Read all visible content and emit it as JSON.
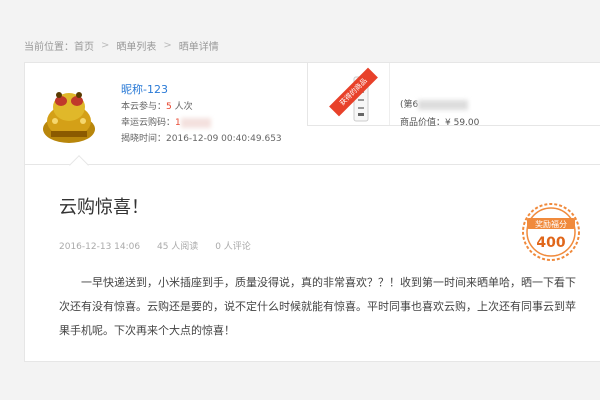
{
  "breadcrumb": {
    "prefix": "当前位置：",
    "items": [
      "首页",
      "晒单列表",
      "晒单详情"
    ]
  },
  "winner": {
    "nickname": "昵称-123",
    "participate_label": "本云参与：",
    "participate_value": "5",
    "participate_unit": "人次",
    "lucky_label": "幸运云购码：",
    "lucky_value": "1",
    "reveal_label": "揭晓时间：",
    "reveal_value": "2016-12-09 00:40:49.653"
  },
  "product": {
    "ribbon": "获得的商品",
    "name_prefix": "(第6",
    "price_label": "商品价值：",
    "price_value": "¥ 59.00"
  },
  "post": {
    "title": "云购惊喜！",
    "date": "2016-12-13 14:06",
    "reads": "45 人阅读",
    "comments": "0 人评论",
    "badge_label": "奖励福分",
    "badge_value": "400",
    "body": "一早快递送到，小米插座到手，质量没得说，真的非常喜欢？？！收到第一时间来晒单哈，晒一下看下次还有没有惊喜。云购还是要的，说不定什么时候就能有惊喜。平时同事也喜欢云购，上次还有同事云到苹果手机呢。下次再来个大点的惊喜！"
  },
  "colors": {
    "accent": "#e8412a",
    "link": "#2a7ad6",
    "badge": "#f08a3c"
  }
}
